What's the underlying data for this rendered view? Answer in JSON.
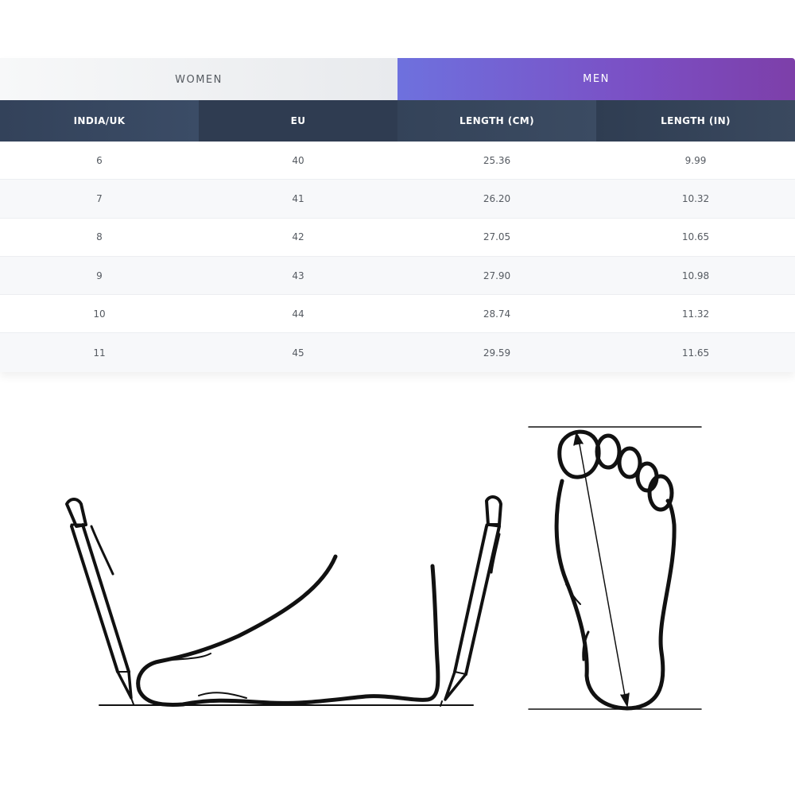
{
  "tabs": [
    {
      "label": "WOMEN",
      "active": false
    },
    {
      "label": "MEN",
      "active": true
    }
  ],
  "table": {
    "headers": [
      "INDIA/UK",
      "EU",
      "LENGTH (CM)",
      "LENGTH (IN)"
    ],
    "rows": [
      [
        "6",
        "40",
        "25.36",
        "9.99"
      ],
      [
        "7",
        "41",
        "26.20",
        "10.32"
      ],
      [
        "8",
        "42",
        "27.05",
        "10.65"
      ],
      [
        "9",
        "43",
        "27.90",
        "10.98"
      ],
      [
        "10",
        "44",
        "28.74",
        "11.32"
      ],
      [
        "11",
        "45",
        "29.59",
        "11.65"
      ]
    ]
  },
  "colors": {
    "header_bg": "#2f3c51",
    "active_tab_start": "#6e71de",
    "active_tab_end": "#7d3fa9",
    "row_alt_bg": "#f7f8fa",
    "cell_text": "#555a61"
  }
}
